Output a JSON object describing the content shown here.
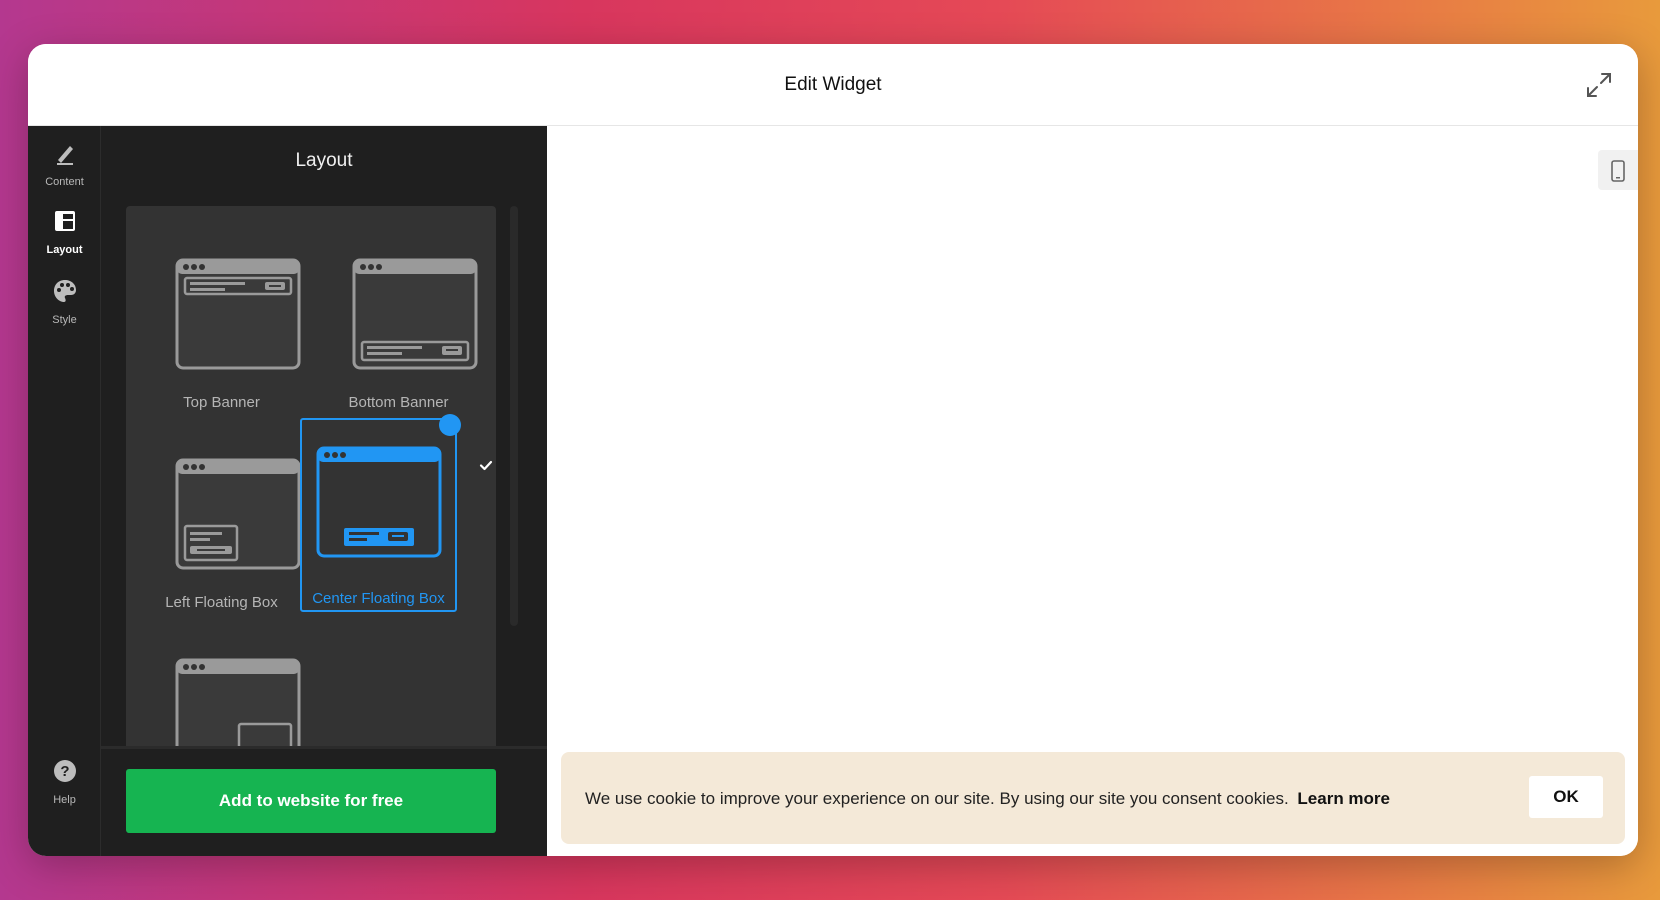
{
  "window": {
    "title": "Edit Widget"
  },
  "rail": {
    "items": [
      {
        "label": "Content",
        "icon": "pencil-icon",
        "active": false
      },
      {
        "label": "Layout",
        "icon": "layout-icon",
        "active": true
      },
      {
        "label": "Style",
        "icon": "palette-icon",
        "active": false
      }
    ],
    "help": {
      "label": "Help",
      "icon": "help-icon"
    }
  },
  "panel": {
    "title": "Layout",
    "options": [
      {
        "label": "Top Banner",
        "selected": false
      },
      {
        "label": "Bottom Banner",
        "selected": false
      },
      {
        "label": "Left Floating Box",
        "selected": false
      },
      {
        "label": "Center Floating Box",
        "selected": true
      },
      {
        "label": "",
        "selected": false
      }
    ],
    "add_button": "Add to website for free"
  },
  "preview": {
    "cookie_text": "We use cookie to improve your experience on our site. By using our site you consent cookies.",
    "learn_more": "Learn more",
    "ok_button": "OK"
  },
  "colors": {
    "accent": "#2196f3",
    "cta": "#16b451",
    "cookie_bg": "#f4e9d8",
    "rail_bg": "#1f1f1f"
  }
}
